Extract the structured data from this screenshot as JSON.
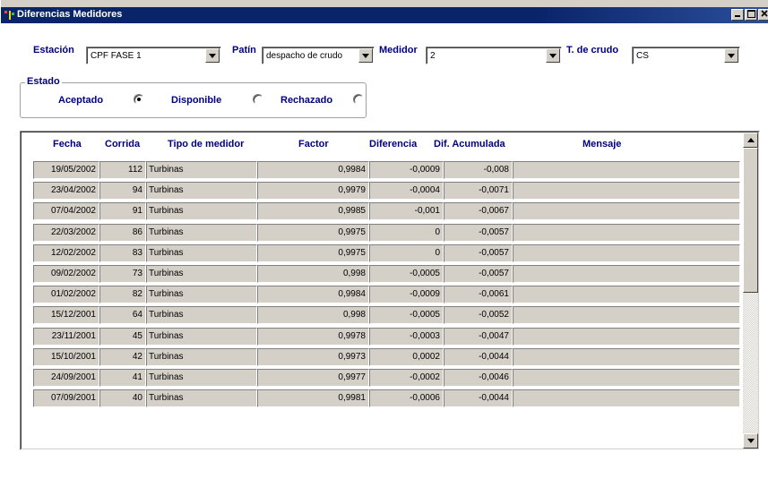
{
  "window": {
    "title": "Diferencias Medidores"
  },
  "filters": {
    "estacion": {
      "label": "Estación",
      "value": "CPF FASE 1"
    },
    "patin": {
      "label": "Patín",
      "value": "despacho de crudo"
    },
    "medidor": {
      "label": "Medidor",
      "value": "2"
    },
    "tipo_crudo": {
      "label": "T. de crudo",
      "value": "CS"
    }
  },
  "estado": {
    "legend": "Estado",
    "options": [
      {
        "label": "Aceptado",
        "checked": true
      },
      {
        "label": "Disponible",
        "checked": false
      },
      {
        "label": "Rechazado",
        "checked": false
      }
    ]
  },
  "grid": {
    "columns": [
      "Fecha",
      "Corrida",
      "Tipo de medidor",
      "Factor",
      "Diferencia",
      "Dif. Acumulada",
      "Mensaje"
    ],
    "rows": [
      {
        "fecha": "19/05/2002",
        "corrida": "112",
        "tipo": "Turbinas",
        "factor": "0,9984",
        "diferencia": "-0,0009",
        "acumulada": "-0,008",
        "mensaje": ""
      },
      {
        "fecha": "23/04/2002",
        "corrida": "94",
        "tipo": "Turbinas",
        "factor": "0,9979",
        "diferencia": "-0,0004",
        "acumulada": "-0,0071",
        "mensaje": ""
      },
      {
        "fecha": "07/04/2002",
        "corrida": "91",
        "tipo": "Turbinas",
        "factor": "0,9985",
        "diferencia": "-0,001",
        "acumulada": "-0,0067",
        "mensaje": ""
      },
      {
        "fecha": "22/03/2002",
        "corrida": "86",
        "tipo": "Turbinas",
        "factor": "0,9975",
        "diferencia": "0",
        "acumulada": "-0,0057",
        "mensaje": ""
      },
      {
        "fecha": "12/02/2002",
        "corrida": "83",
        "tipo": "Turbinas",
        "factor": "0,9975",
        "diferencia": "0",
        "acumulada": "-0,0057",
        "mensaje": ""
      },
      {
        "fecha": "09/02/2002",
        "corrida": "73",
        "tipo": "Turbinas",
        "factor": "0,998",
        "diferencia": "-0,0005",
        "acumulada": "-0,0057",
        "mensaje": ""
      },
      {
        "fecha": "01/02/2002",
        "corrida": "82",
        "tipo": "Turbinas",
        "factor": "0,9984",
        "diferencia": "-0,0009",
        "acumulada": "-0,0061",
        "mensaje": ""
      },
      {
        "fecha": "15/12/2001",
        "corrida": "64",
        "tipo": "Turbinas",
        "factor": "0,998",
        "diferencia": "-0,0005",
        "acumulada": "-0,0052",
        "mensaje": ""
      },
      {
        "fecha": "23/11/2001",
        "corrida": "45",
        "tipo": "Turbinas",
        "factor": "0,9978",
        "diferencia": "-0,0003",
        "acumulada": "-0,0047",
        "mensaje": ""
      },
      {
        "fecha": "15/10/2001",
        "corrida": "42",
        "tipo": "Turbinas",
        "factor": "0,9973",
        "diferencia": "0,0002",
        "acumulada": "-0,0044",
        "mensaje": ""
      },
      {
        "fecha": "24/09/2001",
        "corrida": "41",
        "tipo": "Turbinas",
        "factor": "0,9977",
        "diferencia": "-0,0002",
        "acumulada": "-0,0046",
        "mensaje": ""
      },
      {
        "fecha": "07/09/2001",
        "corrida": "40",
        "tipo": "Turbinas",
        "factor": "0,9981",
        "diferencia": "-0,0006",
        "acumulada": "-0,0044",
        "mensaje": ""
      }
    ]
  },
  "colors": {
    "title_bar": "#0a246a",
    "label": "#000080",
    "face": "#d4d0c8"
  },
  "icons": {
    "window": "app-icon",
    "minimize": "minimize-icon",
    "maximize": "maximize-icon",
    "close": "close-icon"
  }
}
